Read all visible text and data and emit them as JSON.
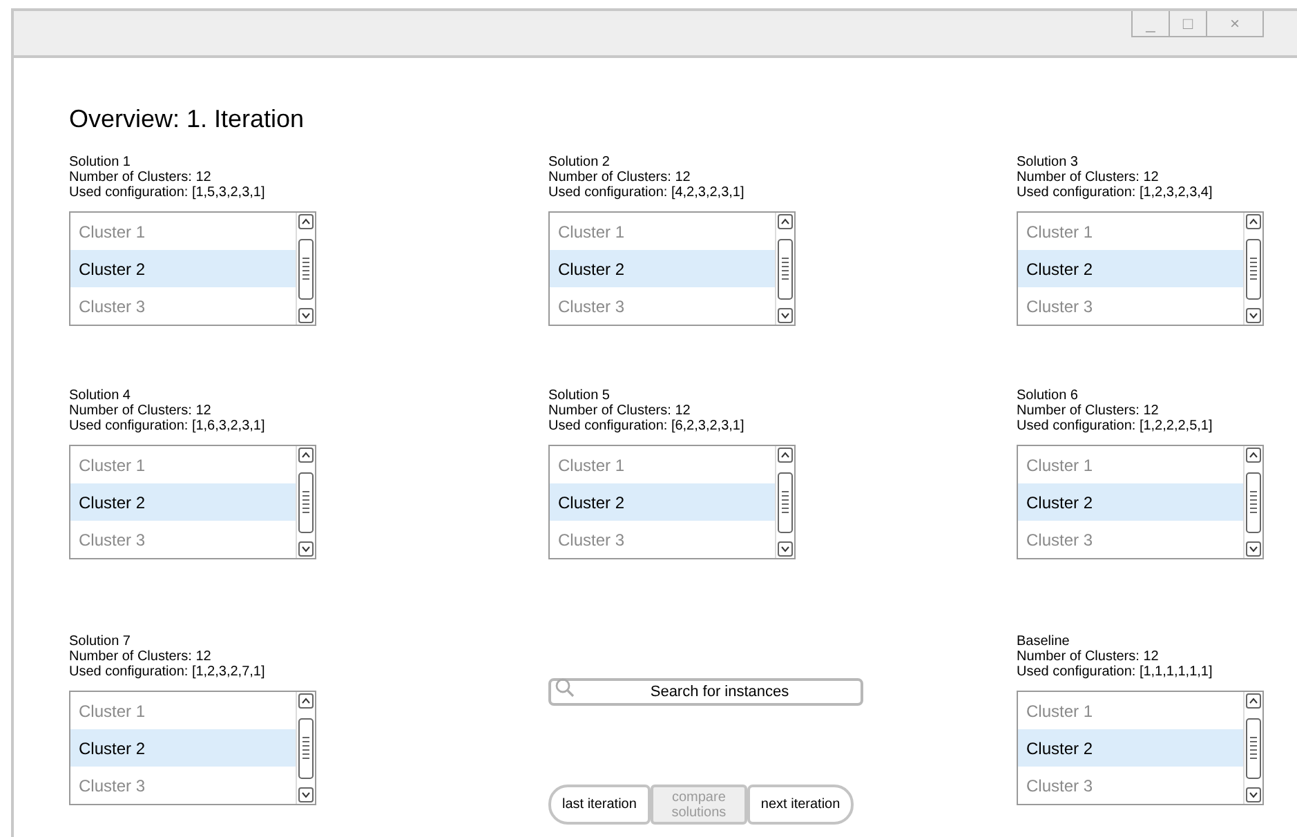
{
  "window": {
    "controls": [
      "_",
      "□",
      "×"
    ]
  },
  "title": "Overview: 1. Iteration",
  "rows": [
    {
      "cells": [
        {
          "kind": "solution",
          "name": "Solution 1",
          "clusters": "Number of Clusters: 12",
          "config": "Used configuration: [1,5,3,2,3,1]",
          "items": [
            {
              "label": "Cluster 1",
              "selected": false
            },
            {
              "label": "Cluster 2",
              "selected": true
            },
            {
              "label": "Cluster 3",
              "selected": false
            }
          ]
        },
        {
          "kind": "solution",
          "name": "Solution 2",
          "clusters": "Number of Clusters: 12",
          "config": "Used configuration: [4,2,3,2,3,1]",
          "items": [
            {
              "label": "Cluster 1",
              "selected": false
            },
            {
              "label": "Cluster 2",
              "selected": true
            },
            {
              "label": "Cluster 3",
              "selected": false
            }
          ]
        },
        {
          "kind": "solution",
          "name": "Solution 3",
          "clusters": "Number of Clusters: 12",
          "config": "Used configuration: [1,2,3,2,3,4]",
          "items": [
            {
              "label": "Cluster 1",
              "selected": false
            },
            {
              "label": "Cluster 2",
              "selected": true
            },
            {
              "label": "Cluster 3",
              "selected": false
            }
          ]
        }
      ]
    },
    {
      "cells": [
        {
          "kind": "solution",
          "name": "Solution 4",
          "clusters": "Number of Clusters: 12",
          "config": "Used configuration: [1,6,3,2,3,1]",
          "items": [
            {
              "label": "Cluster 1",
              "selected": false
            },
            {
              "label": "Cluster 2",
              "selected": true
            },
            {
              "label": "Cluster 3",
              "selected": false
            }
          ]
        },
        {
          "kind": "solution",
          "name": "Solution 5",
          "clusters": "Number of Clusters: 12",
          "config": "Used configuration: [6,2,3,2,3,1]",
          "items": [
            {
              "label": "Cluster 1",
              "selected": false
            },
            {
              "label": "Cluster 2",
              "selected": true
            },
            {
              "label": "Cluster 3",
              "selected": false
            }
          ]
        },
        {
          "kind": "solution",
          "name": "Solution 6",
          "clusters": "Number of Clusters: 12",
          "config": "Used configuration: [1,2,2,2,5,1]",
          "items": [
            {
              "label": "Cluster 1",
              "selected": false
            },
            {
              "label": "Cluster 2",
              "selected": true
            },
            {
              "label": "Cluster 3",
              "selected": false
            }
          ]
        }
      ]
    },
    {
      "cells": [
        {
          "kind": "solution",
          "name": "Solution 7",
          "clusters": "Number of Clusters: 12",
          "config": "Used configuration: [1,2,3,2,7,1]",
          "items": [
            {
              "label": "Cluster 1",
              "selected": false
            },
            {
              "label": "Cluster 2",
              "selected": true
            },
            {
              "label": "Cluster 3",
              "selected": false
            }
          ]
        },
        {
          "kind": "controls",
          "search": {
            "placeholder": "Search for instances"
          },
          "buttons": [
            {
              "label": "last iteration",
              "disabled": false
            },
            {
              "label": "compare solutions",
              "disabled": true
            },
            {
              "label": "next iteration",
              "disabled": false
            }
          ]
        },
        {
          "kind": "solution",
          "name": "Baseline",
          "clusters": "Number of Clusters: 12",
          "config": "Used configuration: [1,1,1,1,1,1]",
          "items": [
            {
              "label": "Cluster 1",
              "selected": false
            },
            {
              "label": "Cluster 2",
              "selected": true
            },
            {
              "label": "Cluster 3",
              "selected": false
            }
          ]
        }
      ]
    }
  ]
}
